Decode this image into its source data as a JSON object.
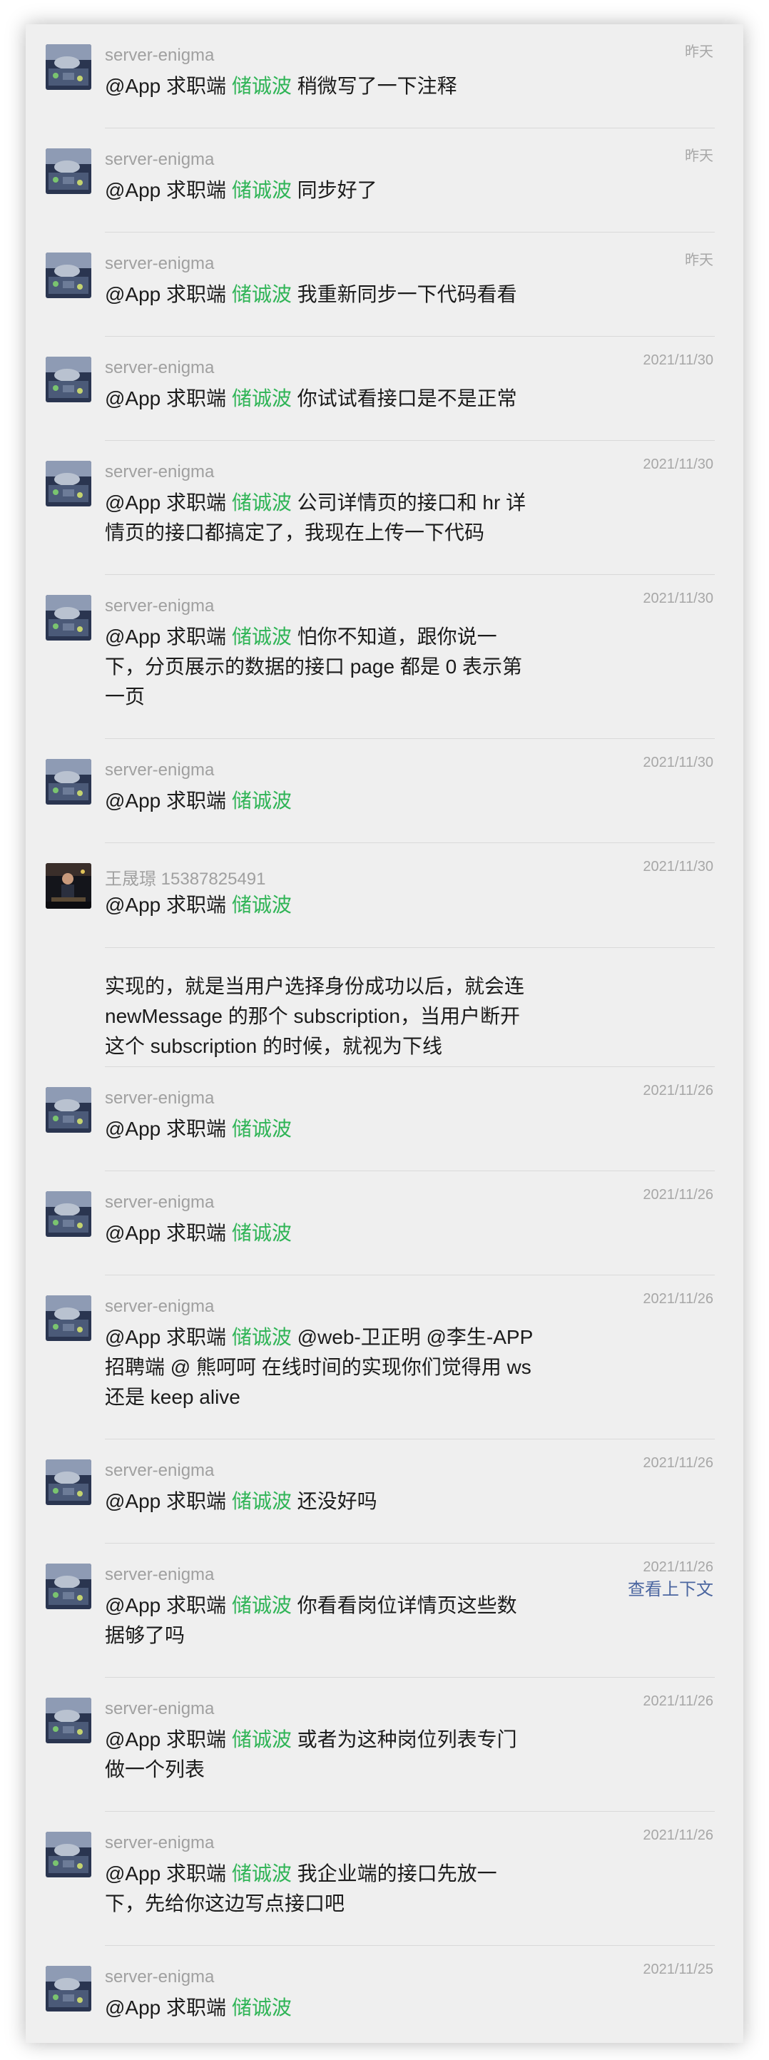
{
  "colors": {
    "panel_bg": "#efefef",
    "highlight_green": "#2fb456",
    "link_blue": "#4b66a0",
    "sender_gray": "#a0a0a0"
  },
  "context_link": "查看上下文",
  "messages": [
    {
      "sender": "server-enigma",
      "time": "昨天",
      "prefix": "@App 求职端 ",
      "mention": "储诚波",
      "text": " 稍微写了一下注释",
      "avatar": "server-avatar"
    },
    {
      "sender": "server-enigma",
      "time": "昨天",
      "prefix": "@App 求职端 ",
      "mention": "储诚波",
      "text": " 同步好了",
      "avatar": "server-avatar"
    },
    {
      "sender": "server-enigma",
      "time": "昨天",
      "prefix": "@App 求职端 ",
      "mention": "储诚波",
      "text": " 我重新同步一下代码看看",
      "avatar": "server-avatar"
    },
    {
      "sender": "server-enigma",
      "time": "2021/11/30",
      "prefix": "@App 求职端 ",
      "mention": "储诚波",
      "text": " 你试试看接口是不是正常",
      "avatar": "server-avatar"
    },
    {
      "sender": "server-enigma",
      "time": "2021/11/30",
      "prefix": "@App 求职端 ",
      "mention": "储诚波",
      "text": " 公司详情页的接口和 hr 详情页的接口都搞定了，我现在上传一下代码",
      "avatar": "server-avatar"
    },
    {
      "sender": "server-enigma",
      "time": "2021/11/30",
      "prefix": "@App 求职端 ",
      "mention": "储诚波",
      "text": " 怕你不知道，跟你说一下，分页展示的数据的接口 page 都是 0 表示第一页",
      "avatar": "server-avatar"
    },
    {
      "sender": "server-enigma",
      "time": "2021/11/30",
      "prefix": "@App 求职端 ",
      "mention": "储诚波",
      "text": "",
      "avatar": "server-avatar"
    },
    {
      "sender": "王晟璟 15387825491",
      "time": "2021/11/30",
      "prefix": "@App 求职端 ",
      "mention": "储诚波",
      "text": "",
      "follow_up": "实现的，就是当用户选择身份成功以后，就会连 newMessage 的那个 subscription，当用户断开这个 subscription 的时候，就视为下线",
      "avatar": "user-photo-avatar"
    },
    {
      "sender": "server-enigma",
      "time": "2021/11/26",
      "prefix": "@App 求职端 ",
      "mention": "储诚波",
      "text": "",
      "avatar": "server-avatar"
    },
    {
      "sender": "server-enigma",
      "time": "2021/11/26",
      "prefix": "@App 求职端 ",
      "mention": "储诚波",
      "text": "",
      "avatar": "server-avatar"
    },
    {
      "sender": "server-enigma",
      "time": "2021/11/26",
      "prefix": "@App 求职端 ",
      "mention": "储诚波",
      "text": " @web-卫正明 @李生-APP 招聘端 @ 熊呵呵 在线时间的实现你们觉得用 ws 还是 keep alive",
      "avatar": "server-avatar"
    },
    {
      "sender": "server-enigma",
      "time": "2021/11/26",
      "prefix": "@App 求职端 ",
      "mention": "储诚波",
      "text": " 还没好吗",
      "avatar": "server-avatar"
    },
    {
      "sender": "server-enigma",
      "time": "2021/11/26",
      "prefix": "@App 求职端 ",
      "mention": "储诚波",
      "text": " 你看看岗位详情页这些数据够了吗",
      "avatar": "server-avatar"
    },
    {
      "sender": "server-enigma",
      "time": "2021/11/26",
      "prefix": "@App 求职端 ",
      "mention": "储诚波",
      "text": " 或者为这种岗位列表专门做一个列表",
      "avatar": "server-avatar"
    },
    {
      "sender": "server-enigma",
      "time": "2021/11/26",
      "prefix": "@App 求职端 ",
      "mention": "储诚波",
      "text": " 我企业端的接口先放一下，先给你这边写点接口吧",
      "avatar": "server-avatar"
    },
    {
      "sender": "server-enigma",
      "time": "2021/11/25",
      "prefix": "@App 求职端 ",
      "mention": "储诚波",
      "text": "",
      "avatar": "server-avatar"
    }
  ]
}
